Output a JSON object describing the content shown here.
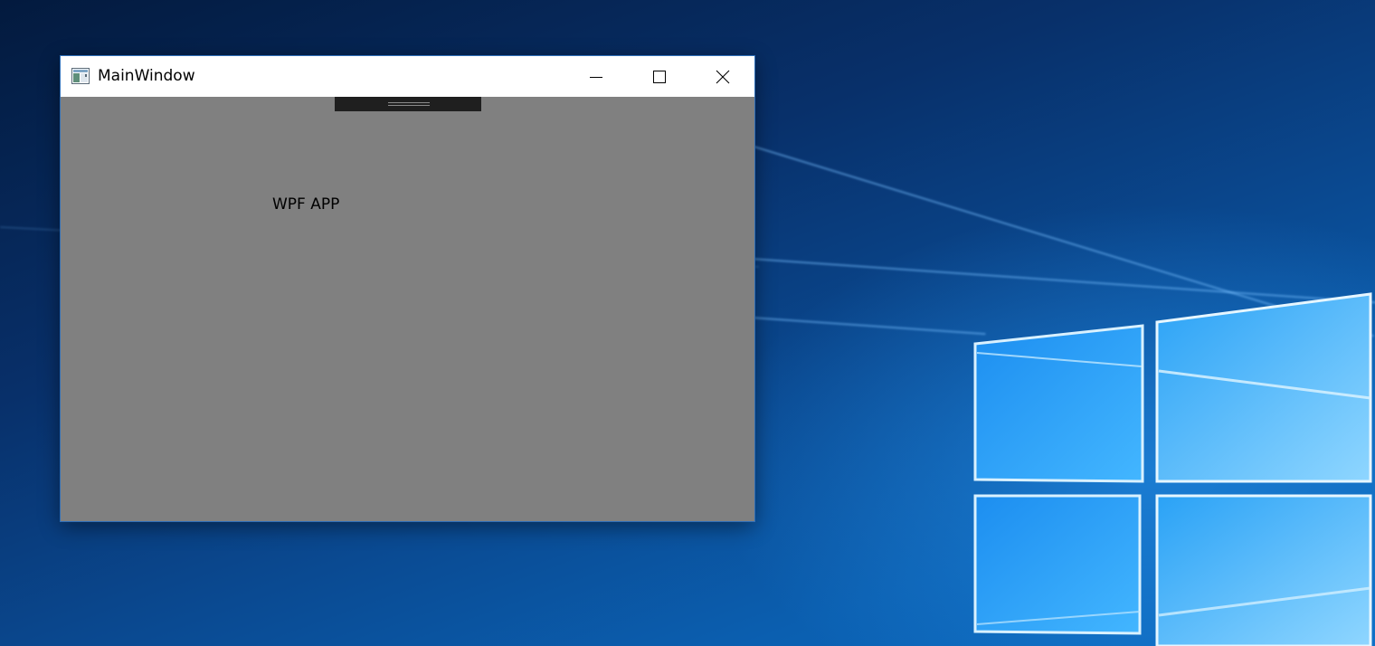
{
  "window": {
    "title": "MainWindow",
    "icon": "app-window-icon",
    "caption_buttons": {
      "minimize_icon": "minimize-icon",
      "maximize_icon": "maximize-icon",
      "close_icon": "close-icon"
    },
    "client_background": "#808080",
    "titlebar_background": "#ffffff"
  },
  "content": {
    "app_label": "WPF APP",
    "toolbar_handle_icon": "grip-handle-icon",
    "toolbar_handle_color": "#1f1f1f"
  },
  "desktop": {
    "wallpaper": "windows-logo-wallpaper",
    "accent": "#0c6cc2"
  }
}
